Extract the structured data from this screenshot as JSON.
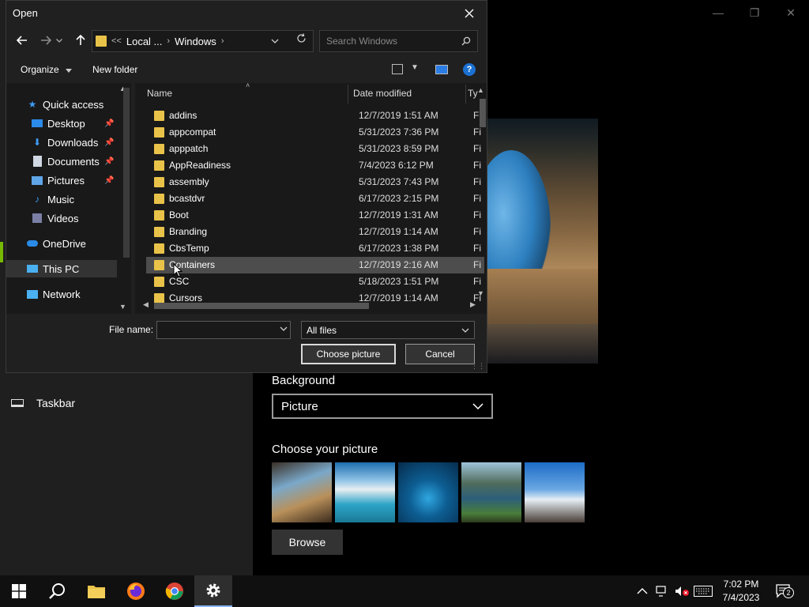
{
  "dialog": {
    "title": "Open",
    "address": {
      "crumb1": "Local ...",
      "crumb2": "Windows",
      "prefix": "<<"
    },
    "search_placeholder": "Search Windows",
    "toolbar": {
      "organize": "Organize",
      "new_folder": "New folder"
    },
    "nav": {
      "quick_access": "Quick access",
      "desktop": "Desktop",
      "downloads": "Downloads",
      "documents": "Documents",
      "pictures": "Pictures",
      "music": "Music",
      "videos": "Videos",
      "onedrive": "OneDrive",
      "this_pc": "This PC",
      "network": "Network"
    },
    "columns": {
      "name": "Name",
      "date": "Date modified",
      "type": "Ty"
    },
    "files": [
      {
        "name": "addins",
        "date": "12/7/2019 1:51 AM",
        "type": "Fi"
      },
      {
        "name": "appcompat",
        "date": "5/31/2023 7:36 PM",
        "type": "Fi"
      },
      {
        "name": "apppatch",
        "date": "5/31/2023 8:59 PM",
        "type": "Fi"
      },
      {
        "name": "AppReadiness",
        "date": "7/4/2023 6:12 PM",
        "type": "Fi"
      },
      {
        "name": "assembly",
        "date": "5/31/2023 7:43 PM",
        "type": "Fi"
      },
      {
        "name": "bcastdvr",
        "date": "6/17/2023 2:15 PM",
        "type": "Fi"
      },
      {
        "name": "Boot",
        "date": "12/7/2019 1:31 AM",
        "type": "Fi"
      },
      {
        "name": "Branding",
        "date": "12/7/2019 1:14 AM",
        "type": "Fi"
      },
      {
        "name": "CbsTemp",
        "date": "6/17/2023 1:38 PM",
        "type": "Fi"
      },
      {
        "name": "Containers",
        "date": "12/7/2019 2:16 AM",
        "type": "Fi"
      },
      {
        "name": "CSC",
        "date": "5/18/2023 1:51 PM",
        "type": "Fi"
      },
      {
        "name": "Cursors",
        "date": "12/7/2019 1:14 AM",
        "type": "Fi"
      }
    ],
    "file_name_label": "File name:",
    "file_name_value": "",
    "filter": "All files",
    "choose_button": "Choose picture",
    "cancel_button": "Cancel"
  },
  "settings": {
    "taskbar_label": "Taskbar",
    "background_label": "Background",
    "background_value": "Picture",
    "choose_label": "Choose your picture",
    "browse_button": "Browse"
  },
  "taskbar": {
    "time": "7:02 PM",
    "date": "7/4/2023",
    "notification_count": "2"
  },
  "colors": {
    "folder": "#e9c349",
    "accent_blue": "#1b71d1",
    "dialog_bg": "#202020",
    "pane_bg": "#191919"
  }
}
